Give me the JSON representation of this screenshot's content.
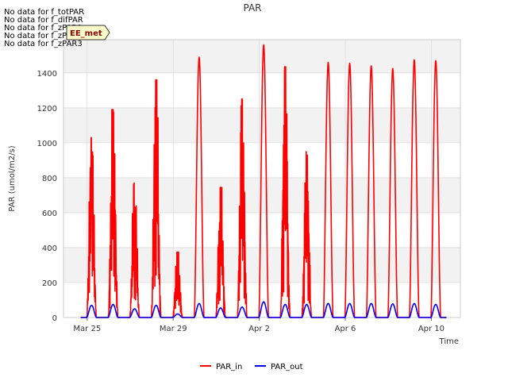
{
  "no_data_notes": [
    "No data for f_totPAR",
    "No data for f_difPAR",
    "No data for f_zPAR1",
    "No data for f_zPAR2",
    "No data for f_zPAR3"
  ],
  "badge": "EE_met",
  "colors": {
    "PAR_in": "#ff0000",
    "PAR_out": "#0000ff",
    "band": "#f2f2f2",
    "grid": "#dcdcdc"
  },
  "chart_data": {
    "type": "line",
    "title": "PAR",
    "xlabel": "Time",
    "ylabel": "PAR (umol/m2/s)",
    "xlim": [
      -1.1,
      17.35
    ],
    "ylim": [
      0,
      1590
    ],
    "x_ticks": [
      {
        "value": 0,
        "label": "Mar 25"
      },
      {
        "value": 4,
        "label": "Mar 29"
      },
      {
        "value": 8,
        "label": "Apr 2"
      },
      {
        "value": 12,
        "label": "Apr 6"
      },
      {
        "value": 16,
        "label": "Apr 10"
      }
    ],
    "y_ticks": [
      0,
      200,
      400,
      600,
      800,
      1000,
      1200,
      1400
    ],
    "grid": true,
    "legend_position": "bottom-center",
    "x_units": "days since Mar 25",
    "series": [
      {
        "name": "PAR_in",
        "daily_peaks": [
          1030,
          1190,
          770,
          1360,
          375,
          1490,
          745,
          1250,
          1560,
          1435,
          950,
          1460,
          1455,
          1440,
          1425,
          1475,
          1470
        ]
      },
      {
        "name": "PAR_out",
        "daily_peaks": [
          70,
          75,
          50,
          70,
          20,
          80,
          55,
          60,
          90,
          75,
          75,
          80,
          80,
          80,
          78,
          80,
          75
        ]
      }
    ]
  },
  "legend": {
    "series1": "PAR_in",
    "series2": "PAR_out"
  }
}
